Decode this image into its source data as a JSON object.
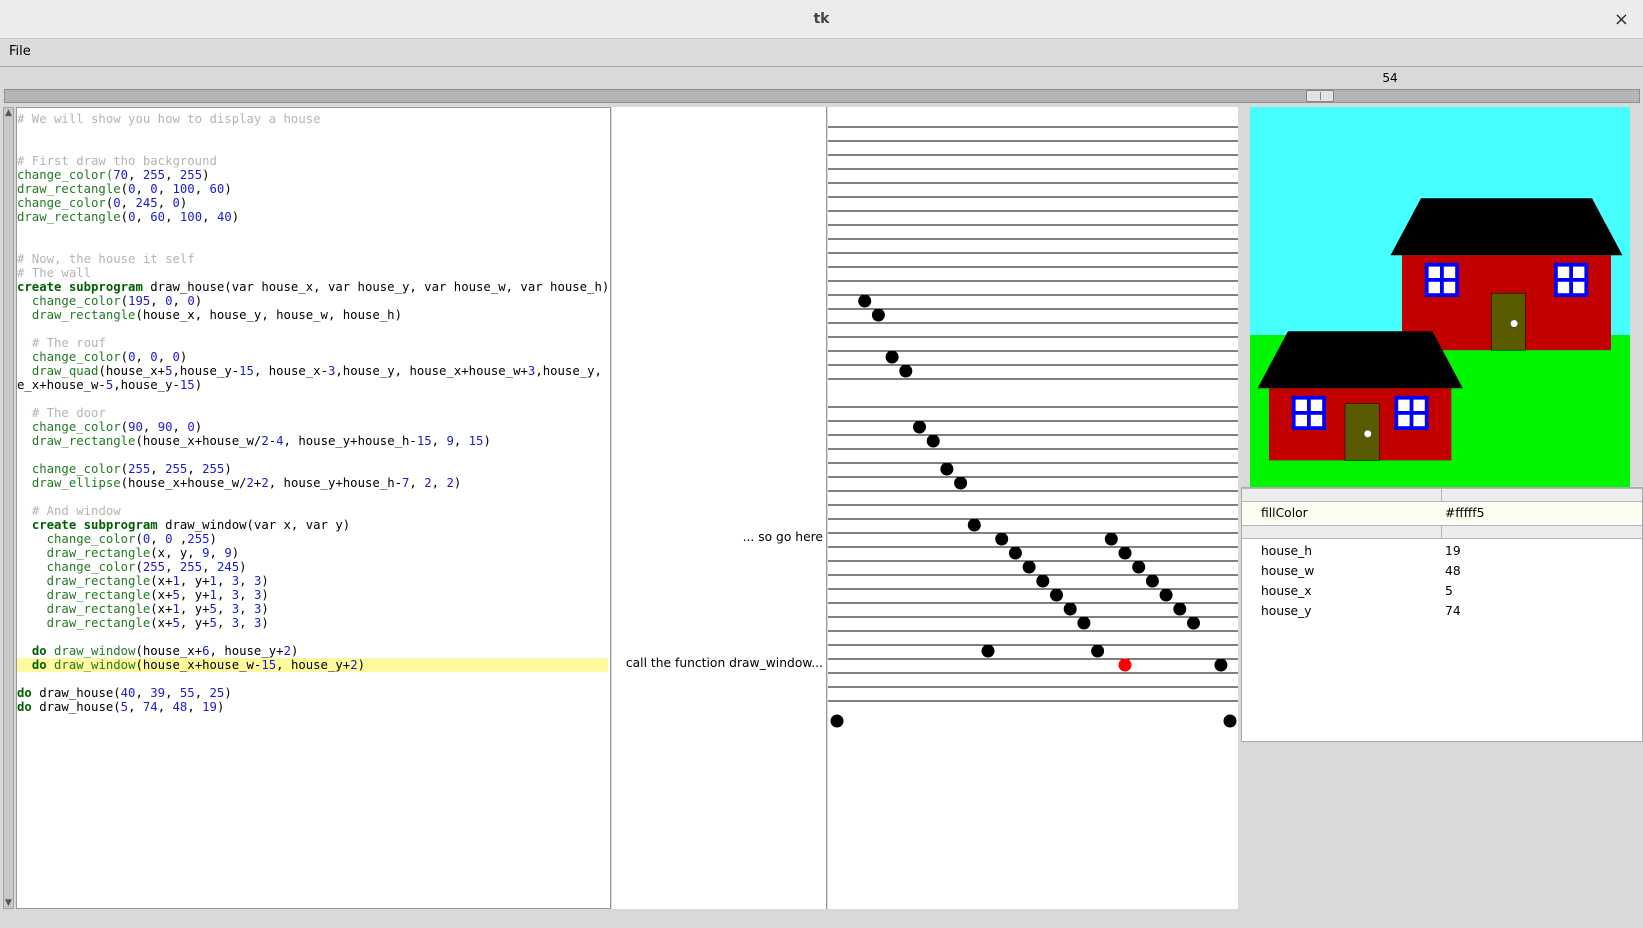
{
  "window": {
    "title": "tk",
    "close_glyph": "×"
  },
  "menu": {
    "file": "File"
  },
  "slider": {
    "value": "54",
    "fraction": 0.81
  },
  "code_lines": [
    {
      "row": 0,
      "tokens": [
        [
          "cm",
          "# We will show you how to display a house"
        ]
      ]
    },
    {
      "row": 3,
      "tokens": [
        [
          "cm",
          "# First draw tho background"
        ]
      ]
    },
    {
      "row": 4,
      "tokens": [
        [
          "fn",
          "change_color"
        ],
        [
          "fn",
          "("
        ],
        [
          "num",
          "70"
        ],
        [
          "tx",
          ", "
        ],
        [
          "num",
          "255"
        ],
        [
          "tx",
          ", "
        ],
        [
          "num",
          "255"
        ],
        [
          "tx",
          ")"
        ]
      ]
    },
    {
      "row": 5,
      "tokens": [
        [
          "fn",
          "draw_rectangle"
        ],
        [
          "tx",
          "("
        ],
        [
          "num",
          "0"
        ],
        [
          "tx",
          ", "
        ],
        [
          "num",
          "0"
        ],
        [
          "tx",
          ", "
        ],
        [
          "num",
          "100"
        ],
        [
          "tx",
          ", "
        ],
        [
          "num",
          "60"
        ],
        [
          "tx",
          ")"
        ]
      ]
    },
    {
      "row": 6,
      "tokens": [
        [
          "fn",
          "change_color"
        ],
        [
          "tx",
          "("
        ],
        [
          "num",
          "0"
        ],
        [
          "tx",
          ", "
        ],
        [
          "num",
          "245"
        ],
        [
          "tx",
          ", "
        ],
        [
          "num",
          "0"
        ],
        [
          "tx",
          ")"
        ]
      ]
    },
    {
      "row": 7,
      "tokens": [
        [
          "fn",
          "draw_rectangle"
        ],
        [
          "tx",
          "("
        ],
        [
          "num",
          "0"
        ],
        [
          "tx",
          ", "
        ],
        [
          "num",
          "60"
        ],
        [
          "tx",
          ", "
        ],
        [
          "num",
          "100"
        ],
        [
          "tx",
          ", "
        ],
        [
          "num",
          "40"
        ],
        [
          "tx",
          ")"
        ]
      ]
    },
    {
      "row": 10,
      "tokens": [
        [
          "cm",
          "# Now, the house it self"
        ]
      ]
    },
    {
      "row": 11,
      "tokens": [
        [
          "cm",
          "# The wall"
        ]
      ]
    },
    {
      "row": 12,
      "tokens": [
        [
          "kw",
          "create subprogram"
        ],
        [
          "tx",
          " draw_house(var house_x, var house_y, var house_w, var house_h)"
        ]
      ]
    },
    {
      "row": 13,
      "tokens": [
        [
          "tx",
          "  "
        ],
        [
          "fn",
          "change_color"
        ],
        [
          "tx",
          "("
        ],
        [
          "num",
          "195"
        ],
        [
          "tx",
          ", "
        ],
        [
          "num",
          "0"
        ],
        [
          "tx",
          ", "
        ],
        [
          "num",
          "0"
        ],
        [
          "tx",
          ")"
        ]
      ]
    },
    {
      "row": 14,
      "tokens": [
        [
          "tx",
          "  "
        ],
        [
          "fn",
          "draw_rectangle"
        ],
        [
          "tx",
          "(house_x, house_y, house_w, house_h)"
        ]
      ]
    },
    {
      "row": 16,
      "tokens": [
        [
          "tx",
          "  "
        ],
        [
          "cm",
          "# The rouf"
        ]
      ]
    },
    {
      "row": 17,
      "tokens": [
        [
          "tx",
          "  "
        ],
        [
          "fn",
          "change_color"
        ],
        [
          "tx",
          "("
        ],
        [
          "num",
          "0"
        ],
        [
          "tx",
          ", "
        ],
        [
          "num",
          "0"
        ],
        [
          "tx",
          ", "
        ],
        [
          "num",
          "0"
        ],
        [
          "tx",
          ")"
        ]
      ]
    },
    {
      "row": 18,
      "tokens": [
        [
          "tx",
          "  "
        ],
        [
          "fn",
          "draw_quad"
        ],
        [
          "tx",
          "(house_x+"
        ],
        [
          "num",
          "5"
        ],
        [
          "tx",
          ",house_y-"
        ],
        [
          "num",
          "15"
        ],
        [
          "tx",
          ", house_x-"
        ],
        [
          "num",
          "3"
        ],
        [
          "tx",
          ",house_y, house_x+house_w+"
        ],
        [
          "num",
          "3"
        ],
        [
          "tx",
          ",house_y, hous"
        ]
      ]
    },
    {
      "row": 19,
      "tokens": [
        [
          "tx",
          "e_x+house_w-"
        ],
        [
          "num",
          "5"
        ],
        [
          "tx",
          ",house_y-"
        ],
        [
          "num",
          "15"
        ],
        [
          "tx",
          ")"
        ]
      ]
    },
    {
      "row": 21,
      "tokens": [
        [
          "tx",
          "  "
        ],
        [
          "cm",
          "# The door"
        ]
      ]
    },
    {
      "row": 22,
      "tokens": [
        [
          "tx",
          "  "
        ],
        [
          "fn",
          "change_color"
        ],
        [
          "tx",
          "("
        ],
        [
          "num",
          "90"
        ],
        [
          "tx",
          ", "
        ],
        [
          "num",
          "90"
        ],
        [
          "tx",
          ", "
        ],
        [
          "num",
          "0"
        ],
        [
          "tx",
          ")"
        ]
      ]
    },
    {
      "row": 23,
      "tokens": [
        [
          "tx",
          "  "
        ],
        [
          "fn",
          "draw_rectangle"
        ],
        [
          "tx",
          "(house_x+house_w/"
        ],
        [
          "num",
          "2"
        ],
        [
          "tx",
          "-"
        ],
        [
          "num",
          "4"
        ],
        [
          "tx",
          ", house_y+house_h-"
        ],
        [
          "num",
          "15"
        ],
        [
          "tx",
          ", "
        ],
        [
          "num",
          "9"
        ],
        [
          "tx",
          ", "
        ],
        [
          "num",
          "15"
        ],
        [
          "tx",
          ")"
        ]
      ]
    },
    {
      "row": 25,
      "tokens": [
        [
          "tx",
          "  "
        ],
        [
          "fn",
          "change_color"
        ],
        [
          "tx",
          "("
        ],
        [
          "num",
          "255"
        ],
        [
          "tx",
          ", "
        ],
        [
          "num",
          "255"
        ],
        [
          "tx",
          ", "
        ],
        [
          "num",
          "255"
        ],
        [
          "tx",
          ")"
        ]
      ]
    },
    {
      "row": 26,
      "tokens": [
        [
          "tx",
          "  "
        ],
        [
          "fn",
          "draw_ellipse"
        ],
        [
          "tx",
          "(house_x+house_w/"
        ],
        [
          "num",
          "2"
        ],
        [
          "tx",
          "+"
        ],
        [
          "num",
          "2"
        ],
        [
          "tx",
          ", house_y+house_h-"
        ],
        [
          "num",
          "7"
        ],
        [
          "tx",
          ", "
        ],
        [
          "num",
          "2"
        ],
        [
          "tx",
          ", "
        ],
        [
          "num",
          "2"
        ],
        [
          "tx",
          ")"
        ]
      ]
    },
    {
      "row": 28,
      "tokens": [
        [
          "tx",
          "  "
        ],
        [
          "cm",
          "# And window"
        ]
      ]
    },
    {
      "row": 29,
      "tokens": [
        [
          "tx",
          "  "
        ],
        [
          "kw",
          "create subprogram"
        ],
        [
          "tx",
          " draw_window(var x, var y)"
        ]
      ]
    },
    {
      "row": 30,
      "tokens": [
        [
          "tx",
          "    "
        ],
        [
          "fn",
          "change_color"
        ],
        [
          "tx",
          "("
        ],
        [
          "num",
          "0"
        ],
        [
          "tx",
          ", "
        ],
        [
          "num",
          "0"
        ],
        [
          "tx",
          " ,"
        ],
        [
          "num",
          "255"
        ],
        [
          "tx",
          ")"
        ]
      ]
    },
    {
      "row": 31,
      "tokens": [
        [
          "tx",
          "    "
        ],
        [
          "fn",
          "draw_rectangle"
        ],
        [
          "tx",
          "(x, y, "
        ],
        [
          "num",
          "9"
        ],
        [
          "tx",
          ", "
        ],
        [
          "num",
          "9"
        ],
        [
          "tx",
          ")"
        ]
      ]
    },
    {
      "row": 32,
      "tokens": [
        [
          "tx",
          "    "
        ],
        [
          "fn",
          "change_color"
        ],
        [
          "tx",
          "("
        ],
        [
          "num",
          "255"
        ],
        [
          "tx",
          ", "
        ],
        [
          "num",
          "255"
        ],
        [
          "tx",
          ", "
        ],
        [
          "num",
          "245"
        ],
        [
          "tx",
          ")"
        ]
      ]
    },
    {
      "row": 33,
      "tokens": [
        [
          "tx",
          "    "
        ],
        [
          "fn",
          "draw_rectangle"
        ],
        [
          "tx",
          "(x+"
        ],
        [
          "num",
          "1"
        ],
        [
          "tx",
          ", y+"
        ],
        [
          "num",
          "1"
        ],
        [
          "tx",
          ", "
        ],
        [
          "num",
          "3"
        ],
        [
          "tx",
          ", "
        ],
        [
          "num",
          "3"
        ],
        [
          "tx",
          ")"
        ]
      ]
    },
    {
      "row": 34,
      "tokens": [
        [
          "tx",
          "    "
        ],
        [
          "fn",
          "draw_rectangle"
        ],
        [
          "tx",
          "(x+"
        ],
        [
          "num",
          "5"
        ],
        [
          "tx",
          ", y+"
        ],
        [
          "num",
          "1"
        ],
        [
          "tx",
          ", "
        ],
        [
          "num",
          "3"
        ],
        [
          "tx",
          ", "
        ],
        [
          "num",
          "3"
        ],
        [
          "tx",
          ")"
        ]
      ]
    },
    {
      "row": 35,
      "tokens": [
        [
          "tx",
          "    "
        ],
        [
          "fn",
          "draw_rectangle"
        ],
        [
          "tx",
          "(x+"
        ],
        [
          "num",
          "1"
        ],
        [
          "tx",
          ", y+"
        ],
        [
          "num",
          "5"
        ],
        [
          "tx",
          ", "
        ],
        [
          "num",
          "3"
        ],
        [
          "tx",
          ", "
        ],
        [
          "num",
          "3"
        ],
        [
          "tx",
          ")"
        ]
      ]
    },
    {
      "row": 36,
      "tokens": [
        [
          "tx",
          "    "
        ],
        [
          "fn",
          "draw_rectangle"
        ],
        [
          "tx",
          "(x+"
        ],
        [
          "num",
          "5"
        ],
        [
          "tx",
          ", y+"
        ],
        [
          "num",
          "5"
        ],
        [
          "tx",
          ", "
        ],
        [
          "num",
          "3"
        ],
        [
          "tx",
          ", "
        ],
        [
          "num",
          "3"
        ],
        [
          "tx",
          ")"
        ]
      ]
    },
    {
      "row": 38,
      "tokens": [
        [
          "tx",
          "  "
        ],
        [
          "kw",
          "do"
        ],
        [
          "tx",
          " "
        ],
        [
          "fn",
          "draw_window"
        ],
        [
          "tx",
          "(house_x+"
        ],
        [
          "num",
          "6"
        ],
        [
          "tx",
          ", house_y+"
        ],
        [
          "num",
          "2"
        ],
        [
          "tx",
          ")"
        ]
      ]
    },
    {
      "row": 39,
      "hl": true,
      "tokens": [
        [
          "tx",
          "  "
        ],
        [
          "kw",
          "do"
        ],
        [
          "tx",
          " "
        ],
        [
          "fn",
          "draw_window"
        ],
        [
          "tx",
          "(house_x+house_w-"
        ],
        [
          "num",
          "15"
        ],
        [
          "tx",
          ", house_y+"
        ],
        [
          "num",
          "2"
        ],
        [
          "tx",
          ")"
        ]
      ]
    },
    {
      "row": 41,
      "tokens": [
        [
          "kw",
          "do"
        ],
        [
          "tx",
          " draw_house("
        ],
        [
          "num",
          "40"
        ],
        [
          "tx",
          ", "
        ],
        [
          "num",
          "39"
        ],
        [
          "tx",
          ", "
        ],
        [
          "num",
          "55"
        ],
        [
          "tx",
          ", "
        ],
        [
          "num",
          "25"
        ],
        [
          "tx",
          ")"
        ]
      ]
    },
    {
      "row": 42,
      "tokens": [
        [
          "kw",
          "do"
        ],
        [
          "tx",
          " draw_house("
        ],
        [
          "num",
          "5"
        ],
        [
          "tx",
          ", "
        ],
        [
          "num",
          "74"
        ],
        [
          "tx",
          ", "
        ],
        [
          "num",
          "48"
        ],
        [
          "tx",
          ", "
        ],
        [
          "num",
          "19"
        ],
        [
          "tx",
          ")"
        ]
      ]
    }
  ],
  "annotations": {
    "go_here": {
      "text": "... so go here",
      "row": 30
    },
    "call_fn": {
      "text": "call the function draw_window...",
      "row": 39
    }
  },
  "trace": {
    "lines_rows": [
      1,
      2,
      3,
      4,
      5,
      6,
      7,
      8,
      9,
      10,
      11,
      12,
      13,
      14,
      15,
      16,
      17,
      18,
      19,
      21,
      22,
      23,
      24,
      25,
      26,
      27,
      28,
      29,
      30,
      31,
      32,
      33,
      34,
      35,
      36,
      37,
      38,
      39,
      40,
      41,
      42
    ],
    "nodes": [
      [
        1,
        13
      ],
      [
        2,
        14
      ],
      [
        3,
        17
      ],
      [
        4,
        18
      ],
      [
        5,
        22
      ],
      [
        6,
        23
      ],
      [
        7,
        25
      ],
      [
        8,
        26
      ],
      [
        9,
        29
      ],
      [
        11,
        30
      ],
      [
        12,
        31
      ],
      [
        13,
        32
      ],
      [
        14,
        33
      ],
      [
        15,
        34
      ],
      [
        16,
        35
      ],
      [
        17,
        36
      ],
      [
        10,
        38
      ],
      [
        19,
        30
      ],
      [
        20,
        31
      ],
      [
        21,
        32
      ],
      [
        22,
        33
      ],
      [
        23,
        34
      ],
      [
        24,
        35
      ],
      [
        25,
        36
      ],
      [
        18,
        38
      ],
      [
        27,
        39
      ]
    ],
    "edge_nodes": [
      [
        0,
        43
      ],
      [
        28,
        43
      ]
    ],
    "current_node": [
      20,
      39
    ],
    "colors": {
      "node": "#000000",
      "current": "#ff0000"
    }
  },
  "canvas": {
    "colors": {
      "sky": "#46ffff",
      "ground": "#00f500",
      "wall": "#c30000",
      "roof": "#000000",
      "door": "#5a5a00",
      "knob": "#ffffff",
      "window": "#0000ff",
      "pane": "#fffff5"
    }
  },
  "variables": {
    "selected": {
      "name": "fillColor",
      "value": "#fffff5"
    },
    "rows": [
      {
        "name": "house_h",
        "value": "19"
      },
      {
        "name": "house_w",
        "value": "48"
      },
      {
        "name": "house_x",
        "value": "5"
      },
      {
        "name": "house_y",
        "value": "74"
      }
    ]
  }
}
